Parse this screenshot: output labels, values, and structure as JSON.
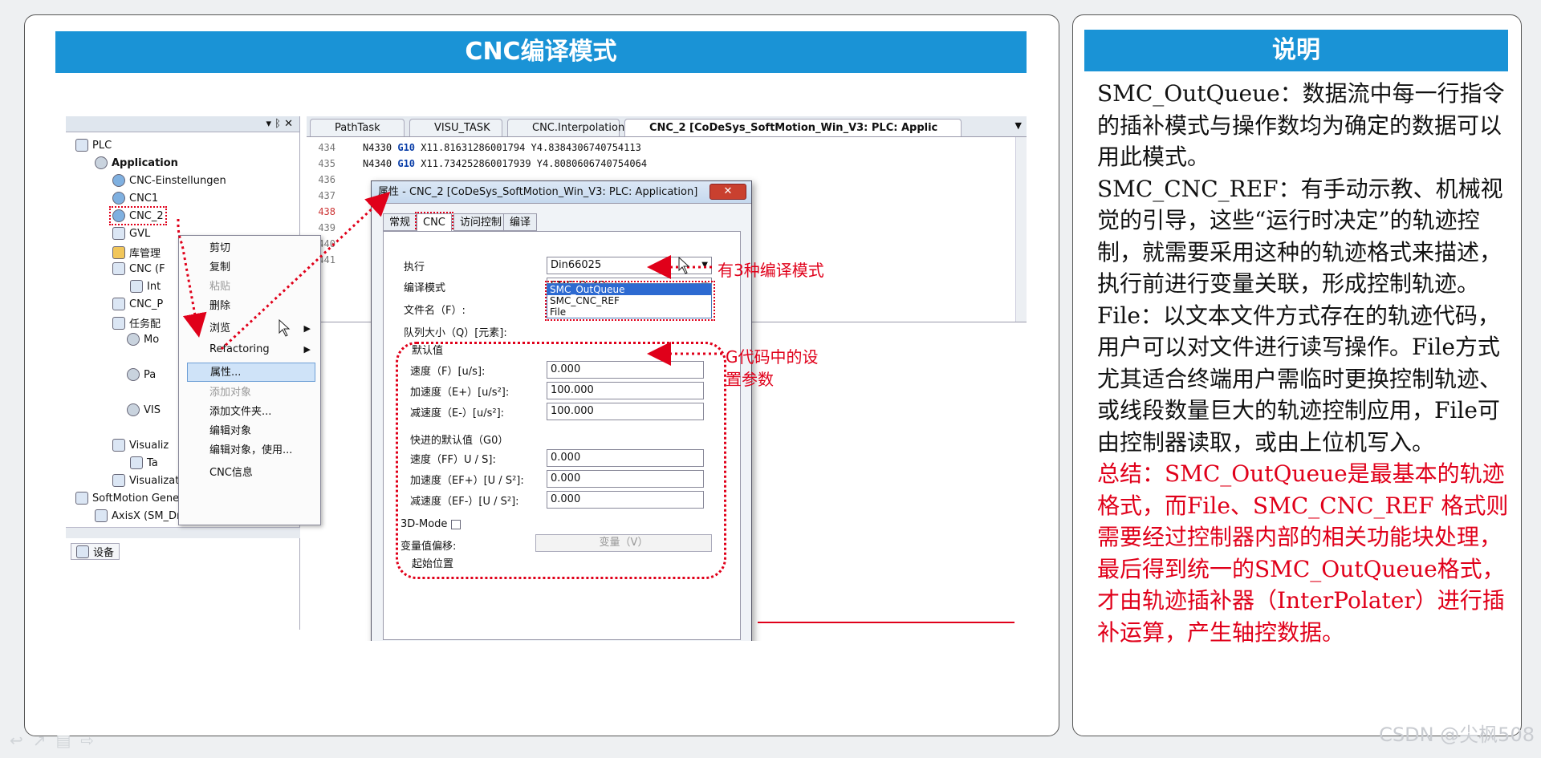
{
  "left_panel": {
    "title": "CNC编译模式"
  },
  "right_panel": {
    "title": "说明",
    "paragraphs": [
      "SMC_OutQueue：数据流中每一行指令的插补模式与操作数均为确定的数据可以用此模式。",
      "SMC_CNC_REF：有手动示教、机械视觉的引导，这些“运行时决定”的轨迹控制，就需要采用这种的轨迹格式来描述，执行前进行变量关联，形成控制轨迹。",
      "File：以文本文件方式存在的轨迹代码，用户可以对文件进行读写操作。File方式尤其适合终端用户需临时更换控制轨迹、或线段数量巨大的轨迹控制应用，File可由控制器读取，或由上位机写入。"
    ],
    "summary": "总结：SMC_OutQueue是最基本的轨迹格式，而File、SMC_CNC_REF 格式则需要经过控制器内部的相关功能块处理，最后得到统一的SMC_OutQueue格式，才由轨迹插补器（InterPolater）进行插补运算，产生轴控数据。"
  },
  "tree": {
    "header": "▾ ᛒ ✕",
    "items": [
      "PLC",
      "Application",
      "CNC-Einstellungen",
      "CNC1",
      "CNC_2",
      "GVL",
      "库管理",
      "CNC (F",
      "Int",
      "CNC_P",
      "任务配",
      "Mo",
      "Pa",
      "VIS",
      "Visualiz",
      "Ta",
      "Visualization",
      "SoftMotion General Axis Pool",
      "AxisX (SM_Drive_Virtual)"
    ],
    "bottom_tab": "设备"
  },
  "editor": {
    "tabs": [
      "PathTask",
      "VISU_TASK",
      "CNC.Interpolation",
      "CNC_2 [CoDeSys_SoftMotion_Win_V3: PLC: Applic"
    ],
    "line_numbers": [
      "434",
      "435",
      "436",
      "437",
      "438",
      "439",
      "440",
      "441"
    ],
    "lines": [
      {
        "n": "N4330",
        "g": "G10",
        "rest": "X11.81631286001794 Y4.8384306740754113"
      },
      {
        "n": "N4340",
        "g": "G10",
        "rest": "X11.734252860017939 Y4.8080606740754064"
      }
    ]
  },
  "context_menu": {
    "items": [
      {
        "label": "剪切",
        "disabled": false
      },
      {
        "label": "复制",
        "disabled": false
      },
      {
        "label": "粘贴",
        "disabled": true
      },
      {
        "label": "删除",
        "disabled": false
      },
      {
        "label": "浏览",
        "disabled": false,
        "submenu": true
      },
      {
        "label": "Refactoring",
        "disabled": false,
        "submenu": true
      },
      {
        "label": "属性...",
        "disabled": false,
        "highlighted": true
      },
      {
        "label": "添加对象",
        "disabled": true
      },
      {
        "label": "添加文件夹...",
        "disabled": false
      },
      {
        "label": "编辑对象",
        "disabled": false
      },
      {
        "label": "编辑对象，使用...",
        "disabled": false
      },
      {
        "label": "CNC信息",
        "disabled": false
      }
    ]
  },
  "dialog": {
    "title": "属性 - CNC_2 [CoDeSys_SoftMotion_Win_V3: PLC: Application]",
    "close": "✕",
    "tabs": [
      "常规",
      "CNC",
      "访问控制",
      "编译"
    ],
    "exec_label": "执行",
    "exec_value": "Din66025",
    "mode_label": "编译模式",
    "mode_value": "SMC_OutQueue",
    "mode_options": [
      "SMC_OutQueue",
      "SMC_CNC_REF",
      "File"
    ],
    "file_label": "文件名（F）:",
    "queue_label": "队列大小（Q）[元素]:",
    "default_group": "默认值",
    "speed_label": "速度（F）[u/s]:",
    "speed_value": "0.000",
    "accel_label": "加速度（E+）[u/s²]:",
    "accel_value": "100.000",
    "decel_label": "减速度（E-）[u/s²]:",
    "decel_value": "100.000",
    "rapid_group": "快进的默认值（G0）",
    "rspeed_label": "速度（FF）U / S]:",
    "rspeed_value": "0.000",
    "raccel_label": "加速度（EF+）[U / S²]:",
    "raccel_value": "0.000",
    "rdecel_label": "减速度（EF-）[U / S²]:",
    "rdecel_value": "0.000",
    "mode3d_label": "3D-Mode",
    "offset_label": "变量值偏移:",
    "var_button": "变量（V）",
    "start_label": "起始位置"
  },
  "annotations": {
    "modes": "有3种编译模式",
    "gcode": "G代码中的设置参数"
  },
  "watermark": "CSDN @尖枫508",
  "colors": {
    "banner": "#1a93d6",
    "annotation": "#e0001a"
  }
}
